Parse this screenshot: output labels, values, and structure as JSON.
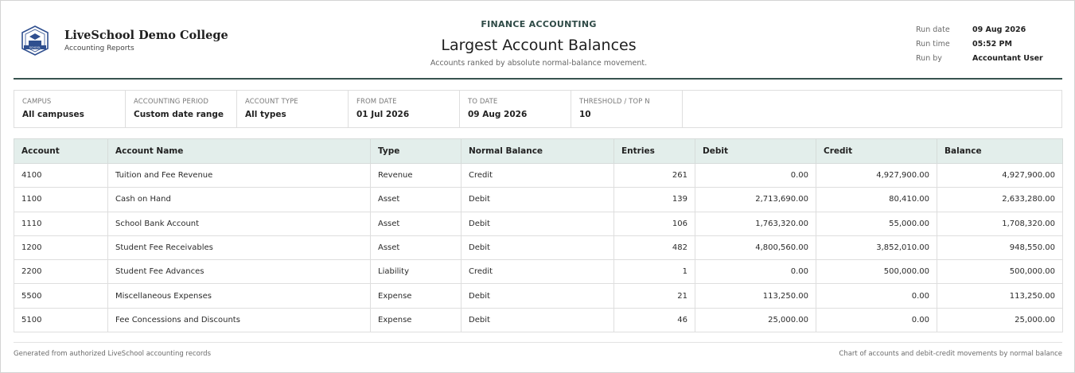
{
  "school": {
    "name": "LiveSchool Demo College",
    "subtitle": "Accounting Reports"
  },
  "report": {
    "kicker": "FINANCE ACCOUNTING",
    "title": "Largest Account Balances",
    "subtitle": "Accounts ranked by absolute normal-balance movement."
  },
  "meta": [
    {
      "label": "Run date",
      "value": "09 Aug 2026"
    },
    {
      "label": "Run time",
      "value": "05:52 PM"
    },
    {
      "label": "Run by",
      "value": "Accountant User"
    }
  ],
  "filters": [
    {
      "label": "CAMPUS",
      "value": "All campuses"
    },
    {
      "label": "ACCOUNTING PERIOD",
      "value": "Custom date range"
    },
    {
      "label": "ACCOUNT TYPE",
      "value": "All types"
    },
    {
      "label": "FROM DATE",
      "value": "01 Jul 2026"
    },
    {
      "label": "TO DATE",
      "value": "09 Aug 2026"
    },
    {
      "label": "THRESHOLD / TOP N",
      "value": "10"
    }
  ],
  "table": {
    "columns": [
      "Account",
      "Account Name",
      "Type",
      "Normal Balance",
      "Entries",
      "Debit",
      "Credit",
      "Balance"
    ],
    "rows": [
      [
        "4100",
        "Tuition and Fee Revenue",
        "Revenue",
        "Credit",
        "261",
        "0.00",
        "4,927,900.00",
        "4,927,900.00"
      ],
      [
        "1100",
        "Cash on Hand",
        "Asset",
        "Debit",
        "139",
        "2,713,690.00",
        "80,410.00",
        "2,633,280.00"
      ],
      [
        "1110",
        "School Bank Account",
        "Asset",
        "Debit",
        "106",
        "1,763,320.00",
        "55,000.00",
        "1,708,320.00"
      ],
      [
        "1200",
        "Student Fee Receivables",
        "Asset",
        "Debit",
        "482",
        "4,800,560.00",
        "3,852,010.00",
        "948,550.00"
      ],
      [
        "2200",
        "Student Fee Advances",
        "Liability",
        "Credit",
        "1",
        "0.00",
        "500,000.00",
        "500,000.00"
      ],
      [
        "5500",
        "Miscellaneous Expenses",
        "Expense",
        "Debit",
        "21",
        "113,250.00",
        "0.00",
        "113,250.00"
      ],
      [
        "5100",
        "Fee Concessions and Discounts",
        "Expense",
        "Debit",
        "46",
        "25,000.00",
        "0.00",
        "25,000.00"
      ]
    ]
  },
  "footer": {
    "left": "Generated from authorized LiveSchool accounting records",
    "right": "Chart of accounts and debit-credit movements by normal balance"
  },
  "logo": {
    "text": "SCHOOL",
    "icon": "school-crest-icon"
  },
  "colors": {
    "accent": "#38534f",
    "header_fill": "#e3eeeb",
    "logo_blue": "#2f4f8f"
  }
}
